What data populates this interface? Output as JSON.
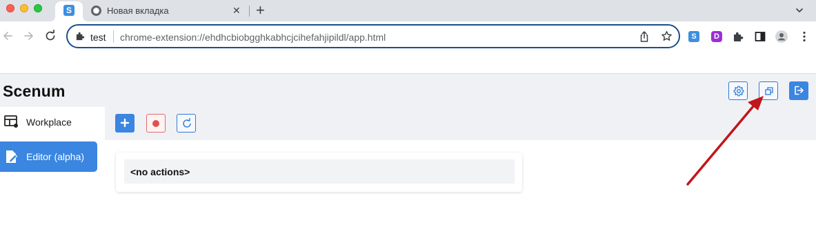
{
  "browser": {
    "tabs": [
      {
        "favicon": "S",
        "title": ""
      },
      {
        "favicon": "chrome-icon",
        "title": "Новая вкладка",
        "close": "✕"
      }
    ],
    "new_tab": "+",
    "omnibox": {
      "site_name": "test",
      "url": "chrome-extension://ehdhcbiobgghkabhcjcihefahjipildl/app.html"
    },
    "extensions": [
      {
        "name": "scenum-extension",
        "letter": "S",
        "color": "#3d8fe0"
      },
      {
        "name": "d-extension",
        "letter": "D",
        "color": "#9b2fd6"
      }
    ]
  },
  "app": {
    "title": "Scenum",
    "accent": "#3a86e0",
    "sidebar": {
      "items": [
        {
          "label": "Workplace",
          "icon": "workplace-icon",
          "active": false
        },
        {
          "label": "Editor (alpha)",
          "icon": "editor-icon",
          "active": true
        }
      ]
    },
    "header_buttons": [
      "settings-icon",
      "open-window-icon",
      "logout-icon"
    ],
    "action_buttons": [
      "add-icon",
      "record-icon",
      "refresh-icon"
    ],
    "actions_placeholder": "<no actions>"
  },
  "annotation": {
    "color": "#c0161c",
    "points_to": "open-window-button"
  }
}
